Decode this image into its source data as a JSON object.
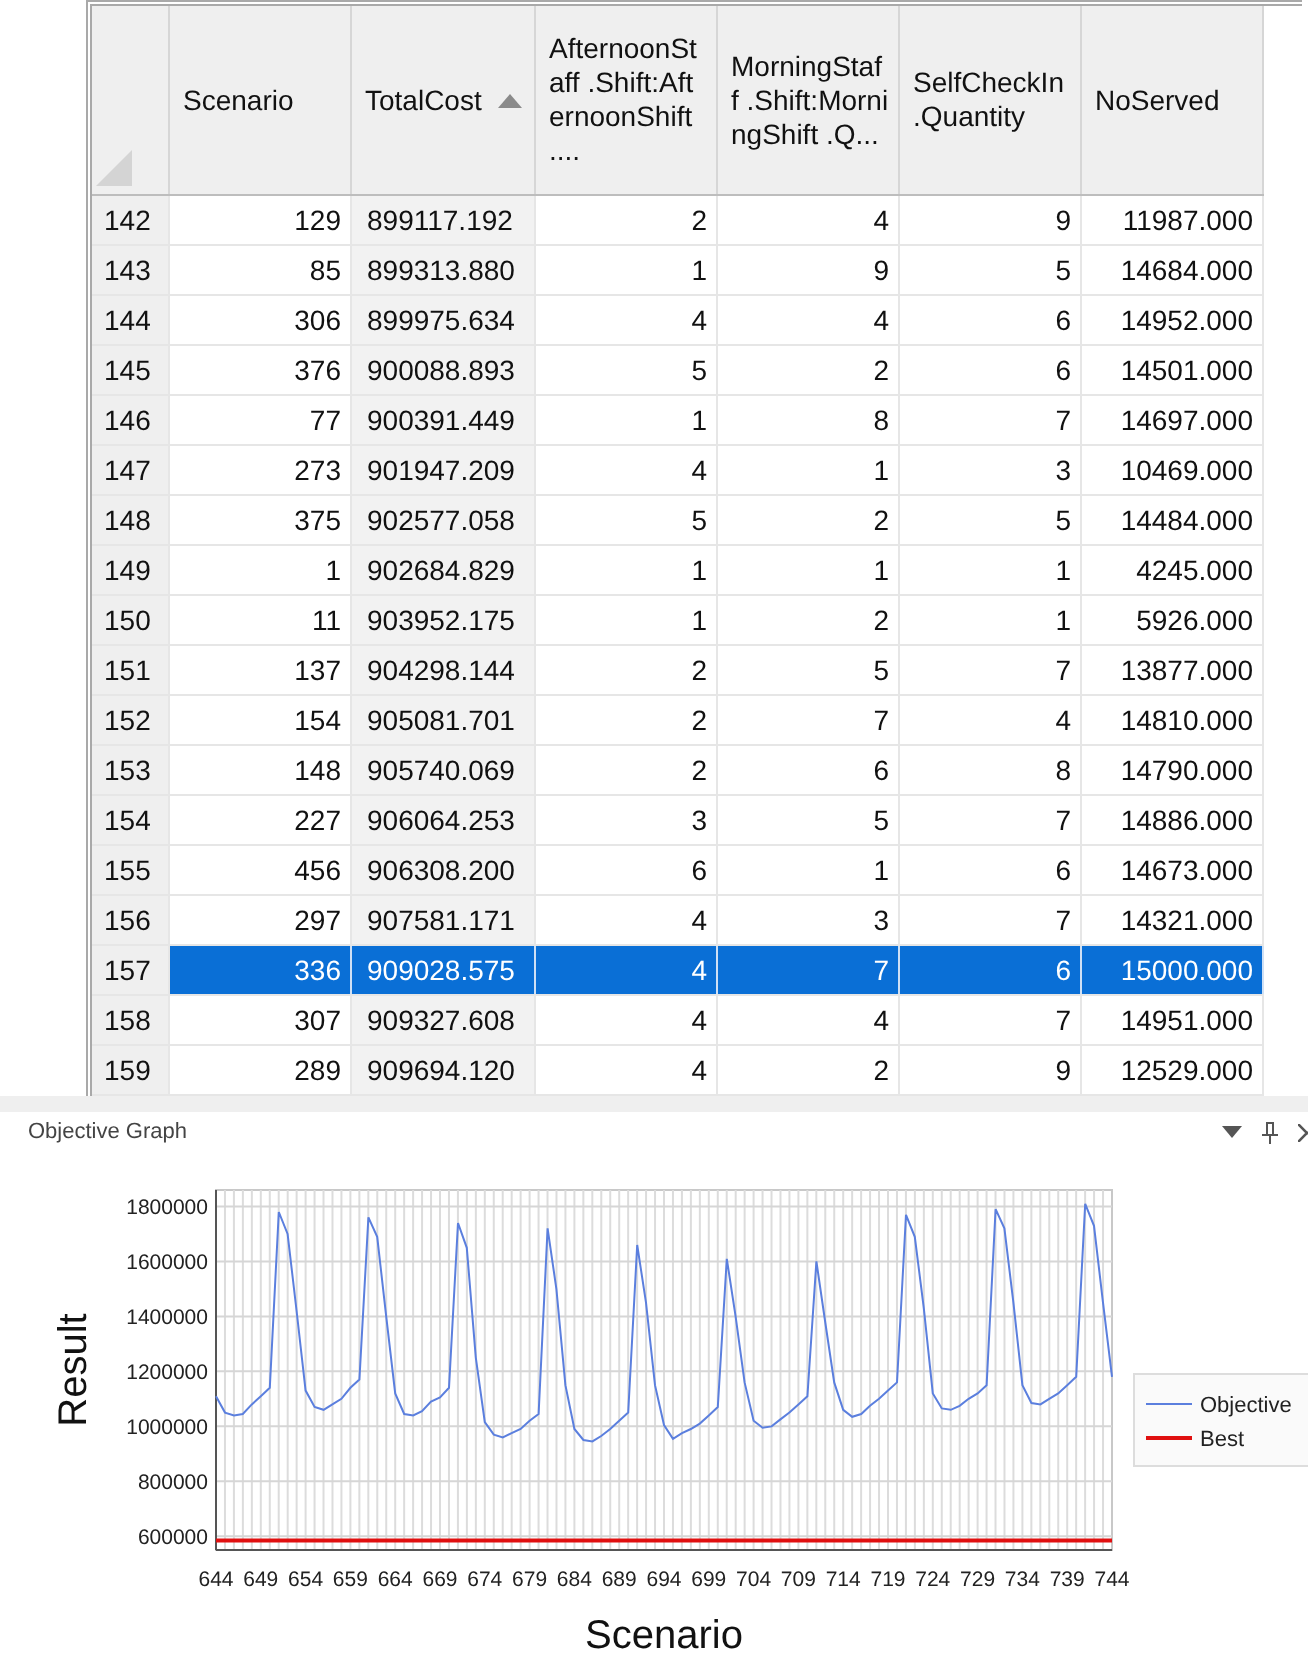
{
  "table": {
    "columns": [
      {
        "label": "Scenario",
        "sorted": false
      },
      {
        "label": "TotalCost",
        "sorted": true
      },
      {
        "label": "AfternoonStaff .Shift:AfternoonShift ....",
        "sorted": false
      },
      {
        "label": "MorningStaff .Shift:MorningShift .Q...",
        "sorted": false
      },
      {
        "label": "SelfCheckIn .Quantity",
        "sorted": false
      },
      {
        "label": "NoServed",
        "sorted": false
      }
    ],
    "rows": [
      {
        "header": "142",
        "cells": [
          "129",
          "899117.192",
          "2",
          "4",
          "9",
          "11987.000"
        ],
        "selected": false
      },
      {
        "header": "143",
        "cells": [
          "85",
          "899313.880",
          "1",
          "9",
          "5",
          "14684.000"
        ],
        "selected": false
      },
      {
        "header": "144",
        "cells": [
          "306",
          "899975.634",
          "4",
          "4",
          "6",
          "14952.000"
        ],
        "selected": false
      },
      {
        "header": "145",
        "cells": [
          "376",
          "900088.893",
          "5",
          "2",
          "6",
          "14501.000"
        ],
        "selected": false
      },
      {
        "header": "146",
        "cells": [
          "77",
          "900391.449",
          "1",
          "8",
          "7",
          "14697.000"
        ],
        "selected": false
      },
      {
        "header": "147",
        "cells": [
          "273",
          "901947.209",
          "4",
          "1",
          "3",
          "10469.000"
        ],
        "selected": false
      },
      {
        "header": "148",
        "cells": [
          "375",
          "902577.058",
          "5",
          "2",
          "5",
          "14484.000"
        ],
        "selected": false
      },
      {
        "header": "149",
        "cells": [
          "1",
          "902684.829",
          "1",
          "1",
          "1",
          "4245.000"
        ],
        "selected": false
      },
      {
        "header": "150",
        "cells": [
          "11",
          "903952.175",
          "1",
          "2",
          "1",
          "5926.000"
        ],
        "selected": false
      },
      {
        "header": "151",
        "cells": [
          "137",
          "904298.144",
          "2",
          "5",
          "7",
          "13877.000"
        ],
        "selected": false
      },
      {
        "header": "152",
        "cells": [
          "154",
          "905081.701",
          "2",
          "7",
          "4",
          "14810.000"
        ],
        "selected": false
      },
      {
        "header": "153",
        "cells": [
          "148",
          "905740.069",
          "2",
          "6",
          "8",
          "14790.000"
        ],
        "selected": false
      },
      {
        "header": "154",
        "cells": [
          "227",
          "906064.253",
          "3",
          "5",
          "7",
          "14886.000"
        ],
        "selected": false
      },
      {
        "header": "155",
        "cells": [
          "456",
          "906308.200",
          "6",
          "1",
          "6",
          "14673.000"
        ],
        "selected": false
      },
      {
        "header": "156",
        "cells": [
          "297",
          "907581.171",
          "4",
          "3",
          "7",
          "14321.000"
        ],
        "selected": false
      },
      {
        "header": "157",
        "cells": [
          "336",
          "909028.575",
          "4",
          "7",
          "6",
          "15000.000"
        ],
        "selected": true
      },
      {
        "header": "158",
        "cells": [
          "307",
          "909327.608",
          "4",
          "4",
          "7",
          "14951.000"
        ],
        "selected": false
      },
      {
        "header": "159",
        "cells": [
          "289",
          "909694.120",
          "4",
          "2",
          "9",
          "12529.000"
        ],
        "selected": false
      }
    ]
  },
  "graph_panel": {
    "title": "Objective Graph",
    "chart_data": {
      "type": "line",
      "xlabel": "Scenario",
      "ylabel": "Result",
      "xlim": [
        644,
        744
      ],
      "ylim": [
        550000,
        1860000
      ],
      "xticks": [
        644,
        649,
        654,
        659,
        664,
        669,
        674,
        679,
        684,
        689,
        694,
        699,
        704,
        709,
        714,
        719,
        724,
        729,
        734,
        739,
        744
      ],
      "yticks": [
        600000,
        800000,
        1000000,
        1200000,
        1400000,
        1600000,
        1800000
      ],
      "grid": true,
      "legend": true,
      "x": [
        644,
        645,
        646,
        647,
        648,
        649,
        650,
        651,
        652,
        653,
        654,
        655,
        656,
        657,
        658,
        659,
        660,
        661,
        662,
        663,
        664,
        665,
        666,
        667,
        668,
        669,
        670,
        671,
        672,
        673,
        674,
        675,
        676,
        677,
        678,
        679,
        680,
        681,
        682,
        683,
        684,
        685,
        686,
        687,
        688,
        689,
        690,
        691,
        692,
        693,
        694,
        695,
        696,
        697,
        698,
        699,
        700,
        701,
        702,
        703,
        704,
        705,
        706,
        707,
        708,
        709,
        710,
        711,
        712,
        713,
        714,
        715,
        716,
        717,
        718,
        719,
        720,
        721,
        722,
        723,
        724,
        725,
        726,
        727,
        728,
        729,
        730,
        731,
        732,
        733,
        734,
        735,
        736,
        737,
        738,
        739,
        740,
        741,
        742,
        743,
        744
      ],
      "series": [
        {
          "name": "Objective",
          "color": "#5b7fde",
          "values": [
            1110000,
            1050000,
            1040000,
            1045000,
            1080000,
            1110000,
            1140000,
            1780000,
            1700000,
            1420000,
            1130000,
            1070000,
            1060000,
            1080000,
            1100000,
            1140000,
            1170000,
            1760000,
            1690000,
            1400000,
            1120000,
            1045000,
            1040000,
            1055000,
            1090000,
            1105000,
            1140000,
            1740000,
            1650000,
            1250000,
            1015000,
            970000,
            960000,
            975000,
            990000,
            1020000,
            1045000,
            1720000,
            1500000,
            1150000,
            990000,
            950000,
            945000,
            965000,
            990000,
            1020000,
            1050000,
            1660000,
            1450000,
            1150000,
            1005000,
            955000,
            975000,
            990000,
            1010000,
            1040000,
            1070000,
            1610000,
            1400000,
            1160000,
            1020000,
            995000,
            1000000,
            1025000,
            1050000,
            1080000,
            1110000,
            1600000,
            1380000,
            1160000,
            1060000,
            1035000,
            1045000,
            1075000,
            1100000,
            1130000,
            1160000,
            1770000,
            1690000,
            1430000,
            1120000,
            1065000,
            1060000,
            1075000,
            1100000,
            1120000,
            1150000,
            1790000,
            1720000,
            1450000,
            1150000,
            1085000,
            1080000,
            1100000,
            1120000,
            1150000,
            1180000,
            1810000,
            1730000,
            1450000,
            1180000
          ]
        },
        {
          "name": "Best",
          "color": "#e01010",
          "values": [
            585000,
            585000,
            585000,
            585000,
            585000,
            585000,
            585000,
            585000,
            585000,
            585000,
            585000,
            585000,
            585000,
            585000,
            585000,
            585000,
            585000,
            585000,
            585000,
            585000,
            585000,
            585000,
            585000,
            585000,
            585000,
            585000,
            585000,
            585000,
            585000,
            585000,
            585000,
            585000,
            585000,
            585000,
            585000,
            585000,
            585000,
            585000,
            585000,
            585000,
            585000,
            585000,
            585000,
            585000,
            585000,
            585000,
            585000,
            585000,
            585000,
            585000,
            585000,
            585000,
            585000,
            585000,
            585000,
            585000,
            585000,
            585000,
            585000,
            585000,
            585000,
            585000,
            585000,
            585000,
            585000,
            585000,
            585000,
            585000,
            585000,
            585000,
            585000,
            585000,
            585000,
            585000,
            585000,
            585000,
            585000,
            585000,
            585000,
            585000,
            585000,
            585000,
            585000,
            585000,
            585000,
            585000,
            585000,
            585000,
            585000,
            585000,
            585000,
            585000,
            585000,
            585000,
            585000,
            585000,
            585000,
            585000,
            585000,
            585000,
            585000
          ]
        }
      ]
    }
  }
}
